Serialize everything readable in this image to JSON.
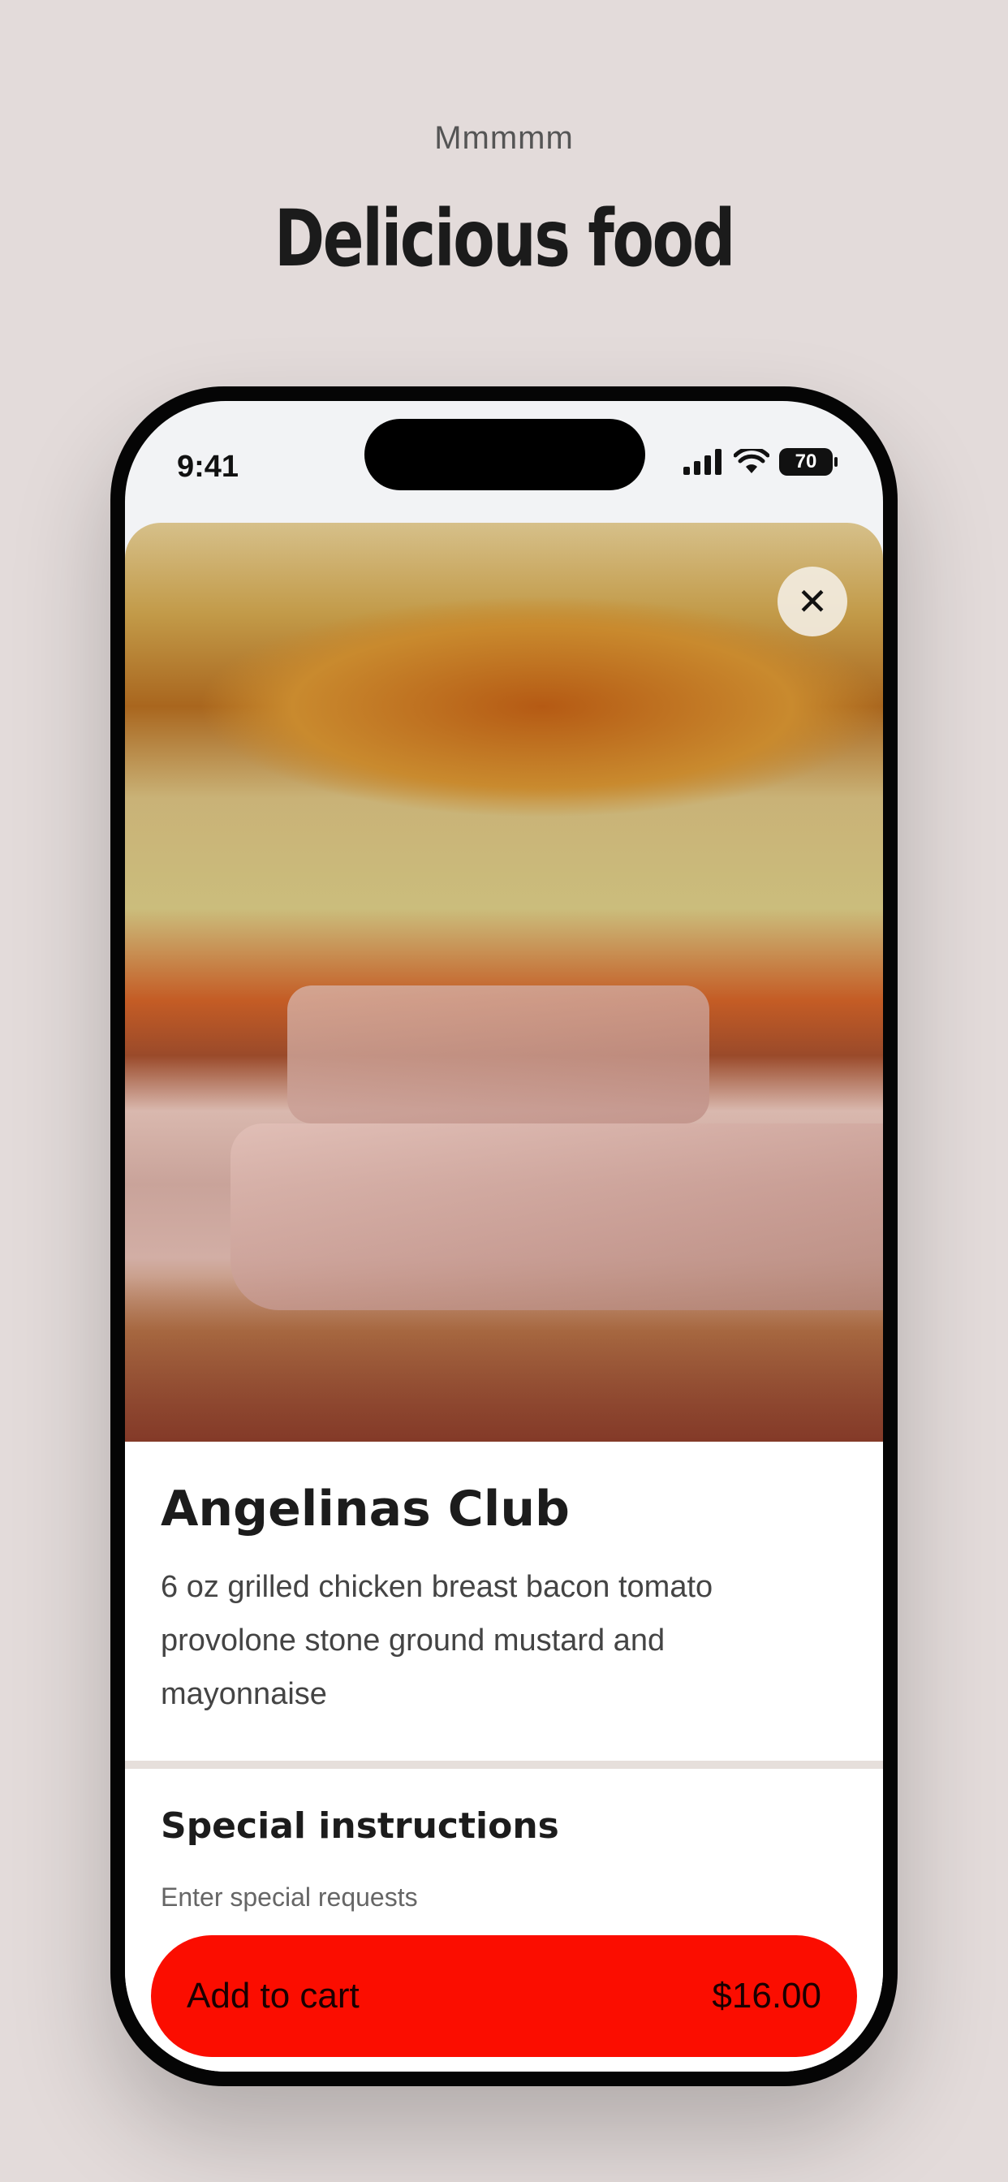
{
  "header": {
    "eyebrow": "Mmmmm",
    "title": "Delicious food"
  },
  "status_bar": {
    "time": "9:41",
    "battery": "70",
    "icons": [
      "signal-icon",
      "wifi-icon",
      "battery-icon"
    ]
  },
  "item": {
    "image": "sandwich-photo",
    "name": "Angelinas Club",
    "description": "6 oz grilled chicken breast bacon tomato provolone stone ground mustard and mayonnaise"
  },
  "special_instructions": {
    "title": "Special instructions",
    "placeholder": "Enter special requests"
  },
  "cart": {
    "label": "Add to cart",
    "price": "$16.00"
  },
  "colors": {
    "accent": "#fb0d00",
    "background": "#e3dbda"
  }
}
